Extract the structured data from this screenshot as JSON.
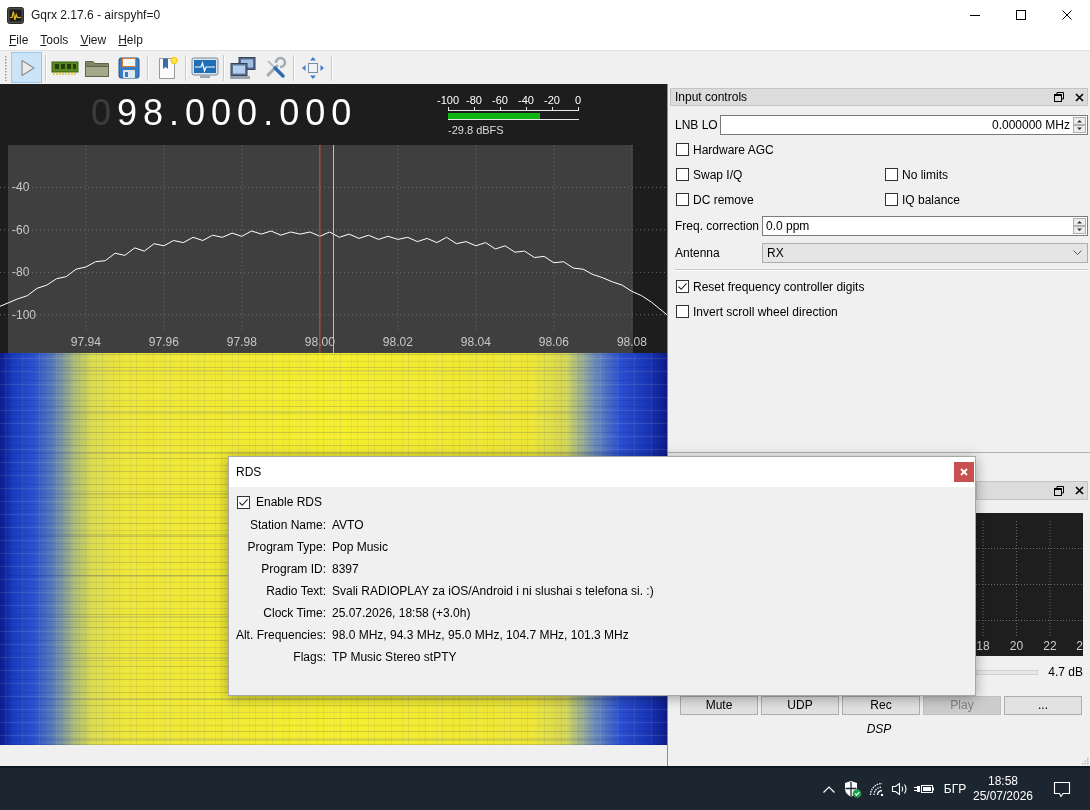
{
  "window": {
    "title": "Gqrx 2.17.6 - airspyhf=0"
  },
  "menu": [
    "File",
    "Tools",
    "View",
    "Help"
  ],
  "toolbar": {
    "run_selected": true
  },
  "frequency": {
    "leading_digit": "0",
    "value": "98.000.000"
  },
  "meter": {
    "scale": [
      "-100",
      "-80",
      "-60",
      "-40",
      "-20",
      "0"
    ],
    "level": 0.7,
    "reading": "-29.8 dBFS"
  },
  "spectrum": {
    "chart_data": {
      "type": "line",
      "x": [
        97.918,
        97.9225,
        97.925,
        97.9275,
        97.93,
        97.9325,
        97.935,
        97.9375,
        97.94,
        97.9425,
        97.945,
        97.9475,
        97.95,
        97.9525,
        97.955,
        97.9575,
        97.96,
        97.9625,
        97.965,
        97.9675,
        97.97,
        97.9725,
        97.975,
        97.9775,
        97.98,
        97.9825,
        97.985,
        97.9875,
        97.99,
        97.9925,
        97.995,
        97.9975,
        98.0,
        98.0025,
        98.005,
        98.0075,
        98.01,
        98.0125,
        98.015,
        98.0175,
        98.02,
        98.0225,
        98.025,
        98.0275,
        98.03,
        98.0325,
        98.035,
        98.0375,
        98.04,
        98.0425,
        98.045,
        98.0475,
        98.05,
        98.0525,
        98.055,
        98.0575,
        98.06,
        98.0625,
        98.065,
        98.0675,
        98.07,
        98.0725,
        98.075,
        98.0775,
        98.08,
        98.0825,
        98.085,
        98.089
      ],
      "values": [
        -96,
        -92.5,
        -91,
        -87.5,
        -86,
        -83,
        -82,
        -78.5,
        -77.5,
        -75,
        -74.5,
        -71,
        -72,
        -68.5,
        -70,
        -66.5,
        -67.5,
        -65,
        -66,
        -63.5,
        -65,
        -62.5,
        -63.5,
        -61.5,
        -63,
        -60.5,
        -62,
        -60.5,
        -62.5,
        -61,
        -62,
        -61,
        -63,
        -61,
        -63.5,
        -62,
        -64,
        -62.5,
        -64.5,
        -63,
        -64.5,
        -63.5,
        -65.5,
        -64,
        -66,
        -63.5,
        -66.5,
        -65.5,
        -67.5,
        -66,
        -69,
        -67.5,
        -70.5,
        -70,
        -73,
        -72.5,
        -75.5,
        -75,
        -78,
        -78.5,
        -81,
        -82.5,
        -84.5,
        -86,
        -89,
        -91,
        -94,
        -100
      ],
      "color": "#ffffff",
      "xlim": [
        97.918,
        98.089
      ],
      "ylim": [
        -118,
        -20
      ],
      "xticks": [
        {
          "value": 97.94,
          "label": "97.94"
        },
        {
          "value": 97.96,
          "label": "97.96"
        },
        {
          "value": 97.98,
          "label": "97.98"
        },
        {
          "value": 98.0,
          "label": "98.00"
        },
        {
          "value": 98.02,
          "label": "98.02"
        },
        {
          "value": 98.04,
          "label": "98.04"
        },
        {
          "value": 98.06,
          "label": "98.06"
        },
        {
          "value": 98.08,
          "label": "98.08"
        }
      ],
      "yticks": [
        -40,
        -60,
        -80,
        -100
      ],
      "grid": true,
      "ref_lines": [
        {
          "axis": "x",
          "value": 98.0,
          "color": "#d9493c"
        },
        {
          "axis": "x",
          "value": 98.0035,
          "color": "#bdbdbd"
        }
      ]
    }
  },
  "input_controls": {
    "title": "Input controls",
    "lnb_lo": {
      "label": "LNB LO",
      "value": "0.000000 MHz"
    },
    "hardware_agc": {
      "label": "Hardware AGC",
      "checked": false
    },
    "options": [
      {
        "label": "Swap I/Q",
        "checked": false
      },
      {
        "label": "No limits",
        "checked": false
      },
      {
        "label": "DC remove",
        "checked": false
      },
      {
        "label": "IQ balance",
        "checked": false
      }
    ],
    "freq_correction": {
      "label": "Freq. correction",
      "value": "0.0 ppm"
    },
    "antenna": {
      "label": "Antenna",
      "value": "RX"
    },
    "settings": [
      {
        "label": "Reset frequency controller digits",
        "checked": true
      },
      {
        "label": "Invert scroll wheel direction",
        "checked": false
      }
    ]
  },
  "audio": {
    "plot_labels": [
      "18",
      "20",
      "22",
      "2"
    ],
    "gain": "4.7 dB",
    "buttons": [
      {
        "label": "Mute",
        "disabled": false
      },
      {
        "label": "UDP",
        "disabled": false
      },
      {
        "label": "Rec",
        "disabled": false
      },
      {
        "label": "Play",
        "disabled": true
      },
      {
        "label": "...",
        "disabled": false
      }
    ],
    "label": "DSP"
  },
  "rds": {
    "title": "RDS",
    "enable": {
      "label": "Enable RDS",
      "checked": true
    },
    "fields": [
      {
        "label": "Station Name:",
        "value": "AVTO"
      },
      {
        "label": "Program Type:",
        "value": "Pop Music"
      },
      {
        "label": "Program ID:",
        "value": "8397"
      },
      {
        "label": "Radio Text:",
        "value": "Svali RADIOPLAY za iOS/Android i ni slushai s telefona si. :)"
      },
      {
        "label": "Clock Time:",
        "value": "25.07.2026, 18:58 (+3.0h)"
      },
      {
        "label": "Alt. Frequencies:",
        "value": "98.0 MHz, 94.3 MHz, 95.0 MHz, 104.7 MHz, 101.3 MHz"
      },
      {
        "label": "Flags:",
        "value": "TP Music Stereo stPTY"
      }
    ]
  },
  "taskbar": {
    "language": "БГР",
    "time": "18:58",
    "date": "25/07/2026"
  }
}
